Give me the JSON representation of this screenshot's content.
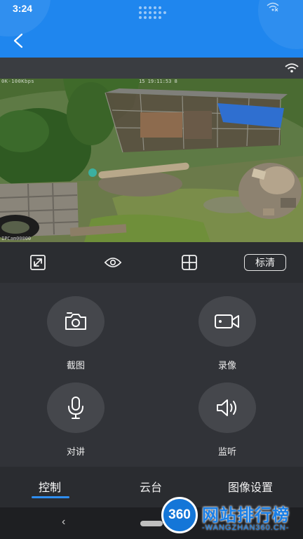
{
  "status_bar": {
    "time": "3:24"
  },
  "video": {
    "osd_top_left": "0K-100Kbps",
    "osd_top_right": "15 19:11:53 8",
    "osd_bottom_left": "IPCam00000"
  },
  "toolbar": {
    "quality_label": "标清"
  },
  "controls": {
    "items": [
      {
        "label": "截图",
        "icon": "camera-icon"
      },
      {
        "label": "录像",
        "icon": "video-camera-icon"
      },
      {
        "label": "对讲",
        "icon": "microphone-icon"
      },
      {
        "label": "监听",
        "icon": "speaker-icon"
      }
    ]
  },
  "tabs": {
    "items": [
      {
        "label": "控制",
        "active": true
      },
      {
        "label": "云台",
        "active": false
      },
      {
        "label": "图像设置",
        "active": false
      }
    ]
  },
  "watermark": {
    "badge": "360",
    "title": "网站排行榜",
    "subtitle": "-WANGZHAN360.CN-"
  },
  "colors": {
    "header_blue": "#1f86ee",
    "accent_blue": "#2f8ef0",
    "panel_dark": "#313338"
  }
}
